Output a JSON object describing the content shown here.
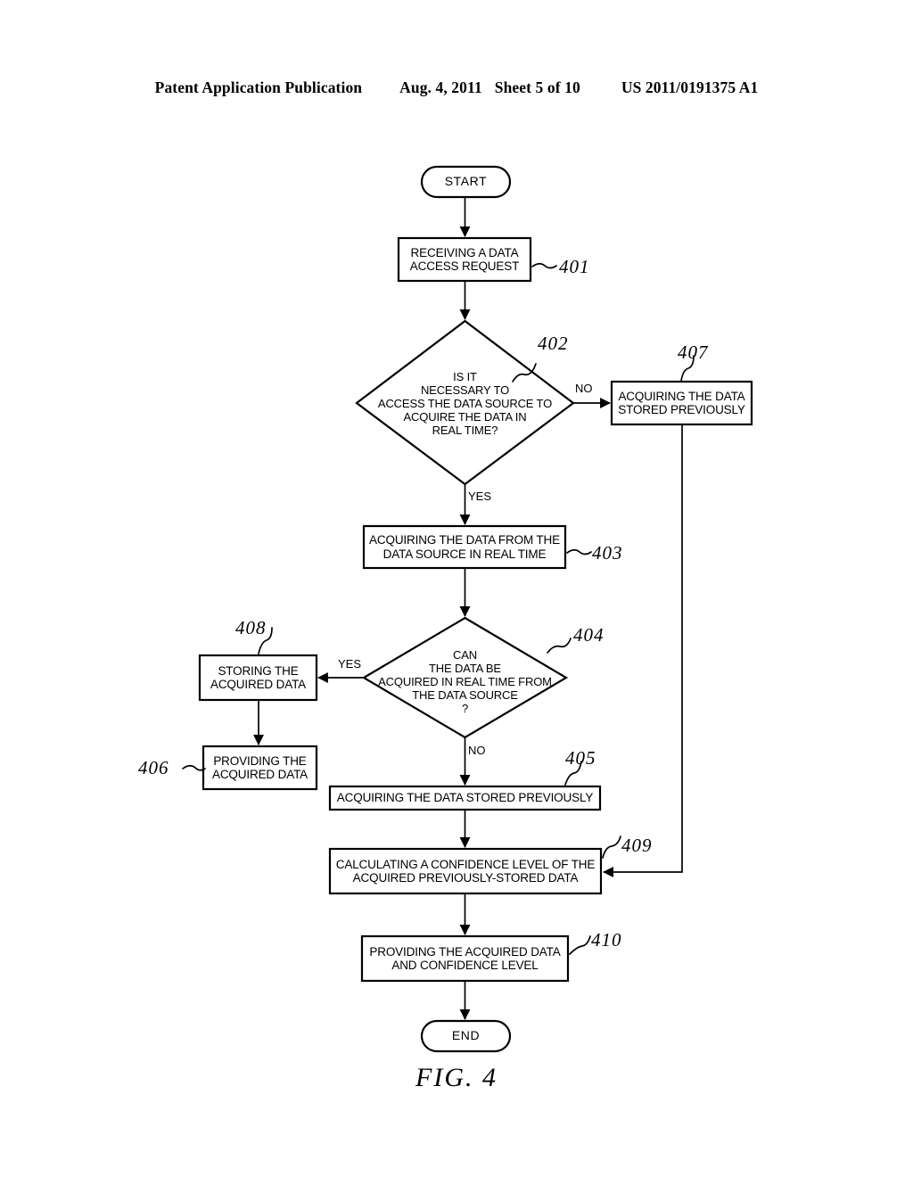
{
  "header": {
    "publication": "Patent Application Publication",
    "date": "Aug. 4, 2011",
    "sheet": "Sheet 5 of 10",
    "patent_number": "US 2011/0191375 A1"
  },
  "figure": {
    "caption": "FIG. 4"
  },
  "flowchart": {
    "start": {
      "label": "START"
    },
    "end": {
      "label": "END"
    },
    "nodes": {
      "n401": {
        "ref": "401",
        "line1": "RECEIVING A DATA",
        "line2": "ACCESS REQUEST"
      },
      "n402": {
        "ref": "402",
        "line1": "IS IT",
        "line2": "NECESSARY TO",
        "line3": "ACCESS THE DATA SOURCE TO",
        "line4": "ACQUIRE THE DATA IN",
        "line5": "REAL TIME?"
      },
      "n403": {
        "ref": "403",
        "line1": "ACQUIRING THE DATA FROM THE",
        "line2": "DATA SOURCE IN REAL TIME"
      },
      "n404": {
        "ref": "404",
        "line1": "CAN",
        "line2": "THE DATA BE",
        "line3": "ACQUIRED IN REAL TIME FROM",
        "line4": "THE DATA SOURCE",
        "line5": "?"
      },
      "n405": {
        "ref": "405",
        "line1": "ACQUIRING THE DATA STORED PREVIOUSLY"
      },
      "n406": {
        "ref": "406",
        "line1": "PROVIDING THE",
        "line2": "ACQUIRED DATA"
      },
      "n407": {
        "ref": "407",
        "line1": "ACQUIRING THE DATA",
        "line2": "STORED PREVIOUSLY"
      },
      "n408": {
        "ref": "408",
        "line1": "STORING THE",
        "line2": "ACQUIRED DATA"
      },
      "n409": {
        "ref": "409",
        "line1": "CALCULATING A CONFIDENCE LEVEL OF THE",
        "line2": "ACQUIRED PREVIOUSLY-STORED DATA"
      },
      "n410": {
        "ref": "410",
        "line1": "PROVIDING THE ACQUIRED DATA",
        "line2": "AND CONFIDENCE LEVEL"
      }
    },
    "edges": {
      "e402_no": "NO",
      "e402_yes": "YES",
      "e404_yes": "YES",
      "e404_no": "NO"
    }
  },
  "colors": {
    "ink": "#000000",
    "paper": "#ffffff"
  }
}
